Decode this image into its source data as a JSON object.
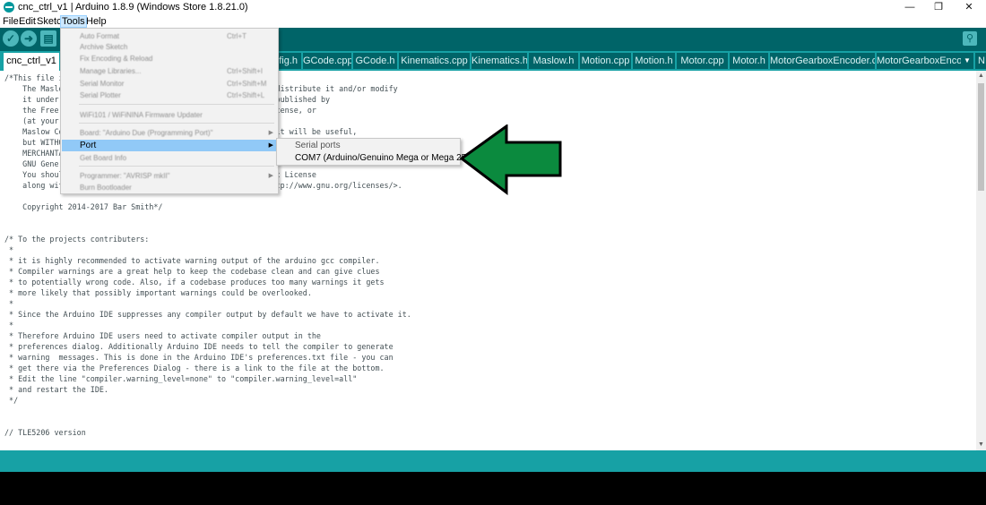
{
  "window": {
    "title": "cnc_ctrl_v1 | Arduino 1.8.9 (Windows Store 1.8.21.0)",
    "minimize": "—",
    "maximize": "❐",
    "close": "✕"
  },
  "menubar": [
    "File",
    "Edit",
    "Sketch",
    "Tools",
    "Help"
  ],
  "toolbar": {
    "verify_icon": "checkmark-icon",
    "upload_icon": "right-arrow-icon",
    "new_icon": "document-icon",
    "serial_monitor_icon": "magnifier-icon"
  },
  "tabs": [
    "cnc_ctrl_v1",
    "Config.h",
    "GCode.cpp",
    "GCode.h",
    "Kinematics.cpp",
    "Kinematics.h",
    "Maslow.h",
    "Motion.cpp",
    "Motion.h",
    "Motor.cpp",
    "Motor.h",
    "MotorGearboxEncoder.cpp",
    "MotorGearboxEncoder",
    "N"
  ],
  "tools_menu": {
    "items": [
      {
        "label": "Auto Format",
        "shortcut": "Ctrl+T"
      },
      {
        "label": "Archive Sketch",
        "shortcut": ""
      },
      {
        "label": "Fix Encoding & Reload",
        "shortcut": ""
      },
      {
        "label": "Manage Libraries...",
        "shortcut": "Ctrl+Shift+I"
      },
      {
        "label": "Serial Monitor",
        "shortcut": "Ctrl+Shift+M"
      },
      {
        "label": "Serial Plotter",
        "shortcut": "Ctrl+Shift+L"
      },
      {
        "label": "WiFi101 / WiFiNINA Firmware Updater",
        "shortcut": ""
      },
      {
        "label": "Board: \"Arduino Due (Programming Port)\"",
        "shortcut": ""
      },
      {
        "label": "Port",
        "shortcut": ""
      },
      {
        "label": "Get Board Info",
        "shortcut": ""
      },
      {
        "label": "Programmer: \"AVRISP mkII\"",
        "shortcut": ""
      },
      {
        "label": "Burn Bootloader",
        "shortcut": ""
      }
    ]
  },
  "port_submenu": {
    "header": "Serial ports",
    "option": "COM7 (Arduino/Genuino Mega or Mega 2560)"
  },
  "editor": {
    "lines": [
      "/*This file is part of the Maslow Control Software.",
      "    The Maslow Control Software is free software: you can redistribute it and/or modify",
      "    it under the terms of the GNU General Public License as published by",
      "    the Free Software Foundation, either version 3 of the License, or",
      "    (at your option) any later version.",
      "    Maslow Control Software is distributed in the hope that it will be useful,",
      "    but WITHOUT ANY WARRANTY; without even the implied warranty of",
      "    MERCHANTABILITY or FITNESS FOR A PARTICULAR PURPOSE.  See the",
      "    GNU General Public License for more details.",
      "    You should have received a copy of the GNU General Public License",
      "    along with the Maslow Control Software.  If not, see <http://www.gnu.org/licenses/>.",
      "",
      "    Copyright 2014-2017 Bar Smith*/",
      "",
      "",
      "/* To the projects contributers:",
      " *",
      " * it is highly recommended to activate warning output of the arduino gcc compiler.",
      " * Compiler warnings are a great help to keep the codebase clean and can give clues",
      " * to potentially wrong code. Also, if a codebase produces too many warnings it gets",
      " * more likely that possibly important warnings could be overlooked.",
      " *",
      " * Since the Arduino IDE suppresses any compiler output by default we have to activate it.",
      " *",
      " * Therefore Arduino IDE users need to activate compiler output in the",
      " * preferences dialog. Additionally Arduino IDE needs to tell the compiler to generate",
      " * warning  messages. This is done in the Arduino IDE's preferences.txt file - you can",
      " * get there via the Preferences Dialog - there is a link to the file at the bottom.",
      " * Edit the line \"compiler.warning_level=none\" to \"compiler.warning_level=all\"",
      " * and restart the IDE.",
      " */",
      "",
      "",
      "// TLE5206 version"
    ]
  },
  "colors": {
    "toolbar": "#006468",
    "tabbar": "#17a1a5",
    "menu_highlight": "#91c9f7",
    "arrow_fill": "#0b8a3e"
  }
}
